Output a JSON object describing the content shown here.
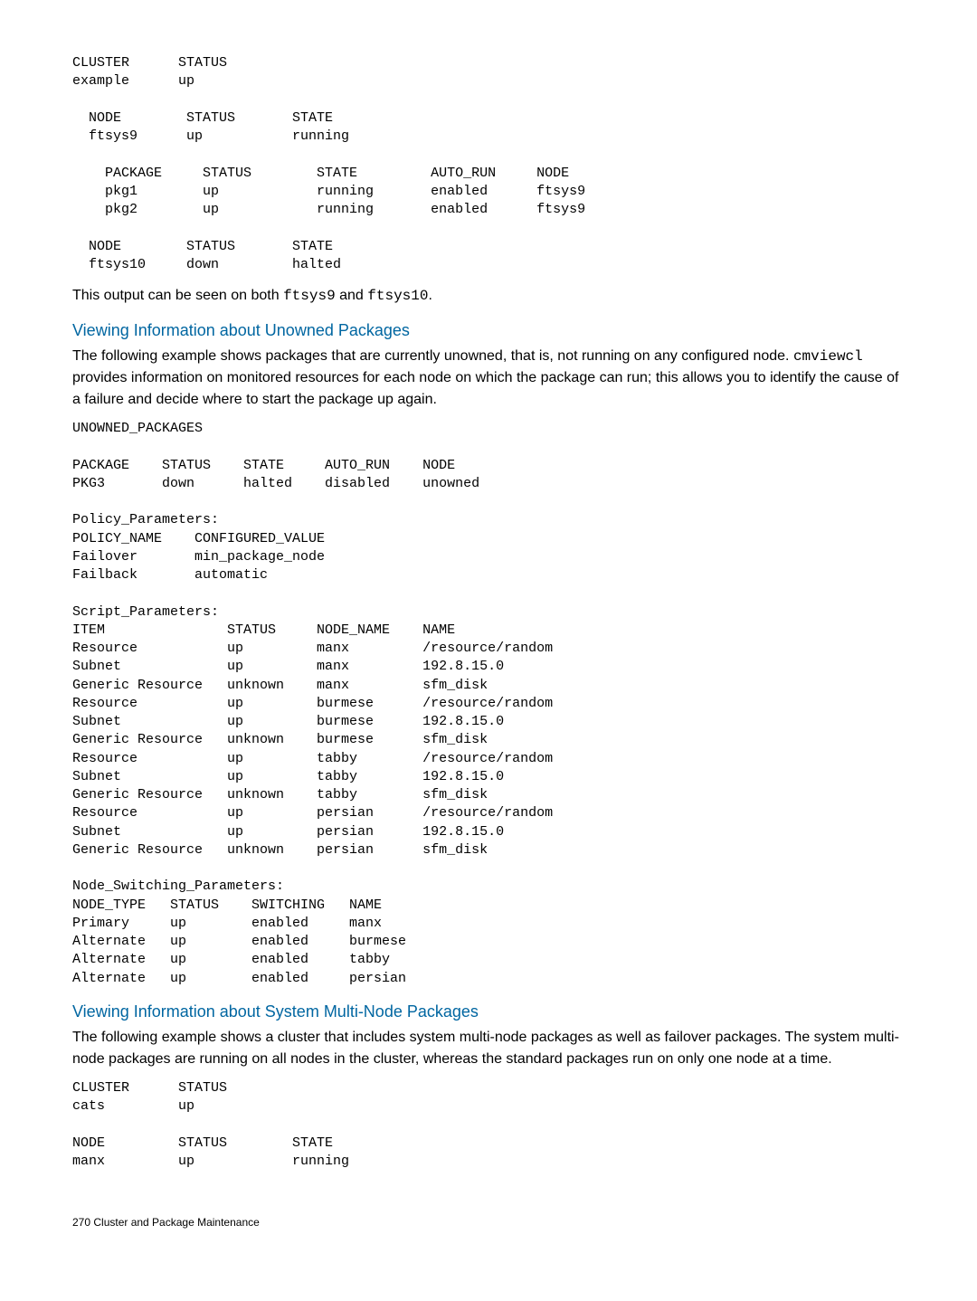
{
  "block1": "CLUSTER      STATUS\nexample      up\n\n  NODE        STATUS       STATE\n  ftsys9      up           running\n\n    PACKAGE     STATUS        STATE         AUTO_RUN     NODE\n    pkg1        up            running       enabled      ftsys9\n    pkg2        up            running       enabled      ftsys9\n\n  NODE        STATUS       STATE\n  ftsys10     down         halted",
  "para1_pre": "This output can be seen on both ",
  "para1_code1": "ftsys9",
  "para1_mid": " and ",
  "para1_code2": "ftsys10",
  "para1_end": ".",
  "section1_heading": "Viewing Information about Unowned Packages",
  "para2_pre": "The following example shows packages that are currently unowned, that is, not running on any configured node. ",
  "para2_code": "cmviewcl",
  "para2_post": " provides information on monitored resources for each node on which the package can run; this allows you to identify the cause of a failure and decide where to start the package up again.",
  "block2": "UNOWNED_PACKAGES\n\nPACKAGE    STATUS    STATE     AUTO_RUN    NODE\nPKG3       down      halted    disabled    unowned\n\nPolicy_Parameters:\nPOLICY_NAME    CONFIGURED_VALUE\nFailover       min_package_node\nFailback       automatic\n\nScript_Parameters:\nITEM               STATUS     NODE_NAME    NAME\nResource           up         manx         /resource/random\nSubnet             up         manx         192.8.15.0\nGeneric Resource   unknown    manx         sfm_disk\nResource           up         burmese      /resource/random\nSubnet             up         burmese      192.8.15.0\nGeneric Resource   unknown    burmese      sfm_disk\nResource           up         tabby        /resource/random\nSubnet             up         tabby        192.8.15.0\nGeneric Resource   unknown    tabby        sfm_disk\nResource           up         persian      /resource/random\nSubnet             up         persian      192.8.15.0\nGeneric Resource   unknown    persian      sfm_disk\n\nNode_Switching_Parameters:\nNODE_TYPE   STATUS    SWITCHING   NAME\nPrimary     up        enabled     manx\nAlternate   up        enabled     burmese\nAlternate   up        enabled     tabby\nAlternate   up        enabled     persian",
  "section2_heading": "Viewing Information about System Multi-Node Packages",
  "para3": "The following example shows a cluster that includes system multi-node packages as well as failover packages. The system multi-node packages are running on all nodes in the cluster, whereas the standard packages run on only one node at a time.",
  "block3": "CLUSTER      STATUS\ncats         up\n\nNODE         STATUS        STATE\nmanx         up            running",
  "footer": "270   Cluster and Package Maintenance"
}
